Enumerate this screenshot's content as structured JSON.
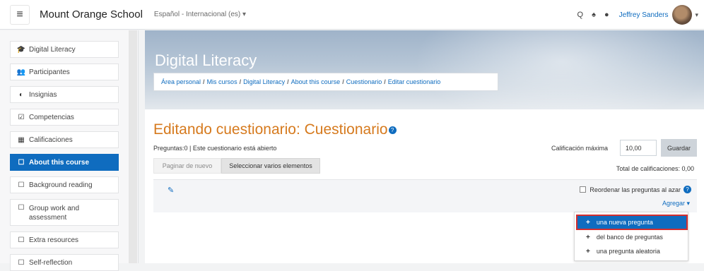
{
  "navbar": {
    "menu_icon": "≡",
    "site_name": "Mount Orange School",
    "language": "Español - Internacional (es) ▾",
    "search_icon": "Q",
    "bell_icon": "♠",
    "chat_icon": "●",
    "user_name": "Jeffrey Sanders",
    "user_caret": "▾"
  },
  "sidebar": {
    "items": [
      {
        "icon": "🎓",
        "label": "Digital Literacy"
      },
      {
        "icon": "👥",
        "label": "Participantes"
      },
      {
        "icon": "◐",
        "label": "Insignias"
      },
      {
        "icon": "☑",
        "label": "Competencias"
      },
      {
        "icon": "▦",
        "label": "Calificaciones"
      },
      {
        "icon": "☐",
        "label": "About this course"
      },
      {
        "icon": "☐",
        "label": "Background reading"
      },
      {
        "icon": "☐",
        "label": "Group work and assessment"
      },
      {
        "icon": "☐",
        "label": "Extra resources"
      },
      {
        "icon": "☐",
        "label": "Self-reflection"
      }
    ]
  },
  "header": {
    "course_title": "Digital Literacy",
    "breadcrumb": [
      "Área personal",
      "Mis cursos",
      "Digital Literacy",
      "About this course",
      "Cuestionario",
      "Editar cuestionario"
    ],
    "breadcrumb_sep": "/"
  },
  "main": {
    "title": "Editando cuestionario: Cuestionario",
    "help_glyph": "?",
    "info": "Preguntas:0 | Este cuestionario está abierto",
    "repaginate_label": "Paginar de nuevo",
    "select_multiple_label": "Seleccionar varios elementos",
    "max_grade_label": "Calificación máxima",
    "max_grade_value": "10,00",
    "save_label": "Guardar",
    "total_grades": "Total de calificaciones: 0,00",
    "edit_icon": "✎",
    "shuffle_label": "Reordenar las preguntas al azar",
    "add_label": "Agregar ▾"
  },
  "add_menu": {
    "items": [
      {
        "icon": "+",
        "label": "una nueva pregunta"
      },
      {
        "icon": "+",
        "label": "del banco de preguntas"
      },
      {
        "icon": "+",
        "label": "una pregunta aleatoria"
      }
    ]
  },
  "colors": {
    "accent": "#0f6cbf",
    "title_orange": "#d67a1e",
    "highlight_red": "#d32f2f"
  }
}
